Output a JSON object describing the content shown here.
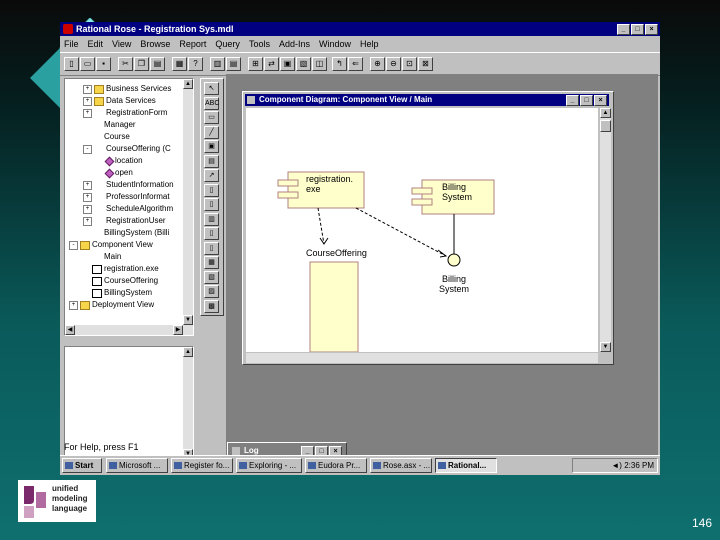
{
  "window": {
    "title": "Rational Rose - Registration Sys.mdl"
  },
  "menu": [
    "File",
    "Edit",
    "View",
    "Browse",
    "Report",
    "Query",
    "Tools",
    "Add-Ins",
    "Window",
    "Help"
  ],
  "browser": {
    "items": [
      {
        "label": "Business Services",
        "type": "folder",
        "indent": 1,
        "expander": "+"
      },
      {
        "label": "Data Services",
        "type": "folder",
        "indent": 1,
        "expander": "+"
      },
      {
        "label": "RegistrationForm",
        "type": "class",
        "indent": 1,
        "expander": "+"
      },
      {
        "label": "Manager",
        "type": "class",
        "indent": 1,
        "expander": ""
      },
      {
        "label": "Course",
        "type": "class",
        "indent": 1,
        "expander": ""
      },
      {
        "label": "CourseOffering (C",
        "type": "class",
        "indent": 1,
        "expander": "-"
      },
      {
        "label": "location",
        "type": "op",
        "indent": 2,
        "expander": ""
      },
      {
        "label": "open",
        "type": "op",
        "indent": 2,
        "expander": ""
      },
      {
        "label": "StudentInformation",
        "type": "class",
        "indent": 1,
        "expander": "+"
      },
      {
        "label": "ProfessorInformat",
        "type": "class",
        "indent": 1,
        "expander": "+"
      },
      {
        "label": "ScheduleAlgorithm",
        "type": "class",
        "indent": 1,
        "expander": "+"
      },
      {
        "label": "RegistrationUser",
        "type": "class",
        "indent": 1,
        "expander": "+"
      },
      {
        "label": "BillingSystem (Billi",
        "type": "class",
        "indent": 1,
        "expander": ""
      },
      {
        "label": "Component View",
        "type": "folder",
        "indent": 0,
        "expander": "-"
      },
      {
        "label": "Main",
        "type": "class",
        "indent": 1,
        "expander": ""
      },
      {
        "label": "registration.exe",
        "type": "comp",
        "indent": 1,
        "expander": ""
      },
      {
        "label": "CourseOffering",
        "type": "comp",
        "indent": 1,
        "expander": ""
      },
      {
        "label": "BillingSystem",
        "type": "comp",
        "indent": 1,
        "expander": ""
      },
      {
        "label": "Deployment View",
        "type": "folder",
        "indent": 0,
        "expander": "+"
      }
    ]
  },
  "palette": [
    "↖",
    "ABC",
    "▭",
    "╱",
    "▣",
    "▤",
    "↗",
    "▯",
    "▯",
    "▥",
    "▯",
    "▯",
    "▦",
    "▧",
    "▨",
    "▩"
  ],
  "diagram": {
    "title": "Component Diagram: Component View / Main",
    "components": [
      {
        "name": "registration.exe",
        "lines": [
          "registration.",
          "exe"
        ]
      },
      {
        "name": "Billing System",
        "lines": [
          "Billing",
          "System"
        ]
      },
      {
        "name": "CourseOffering",
        "lines": [
          "CourseOffering"
        ]
      }
    ],
    "interface_label": [
      "Billing",
      "System"
    ]
  },
  "log": {
    "title": "Log"
  },
  "status": {
    "text": "For Help, press F1"
  },
  "taskbar": {
    "start": "Start",
    "tasks": [
      "Microsoft ...",
      "Register fo...",
      "Exploring - ...",
      "Eudora Pr...",
      "Rose.asx - ...",
      "Rational..."
    ],
    "clock": "2:36 PM"
  },
  "logo": {
    "lines": [
      "unified",
      "modeling",
      "language"
    ]
  },
  "page_number": "146",
  "colors": {
    "titlebar": "#000080",
    "component_fill": "#ffffcc",
    "desktop": "#0a5a5a"
  }
}
